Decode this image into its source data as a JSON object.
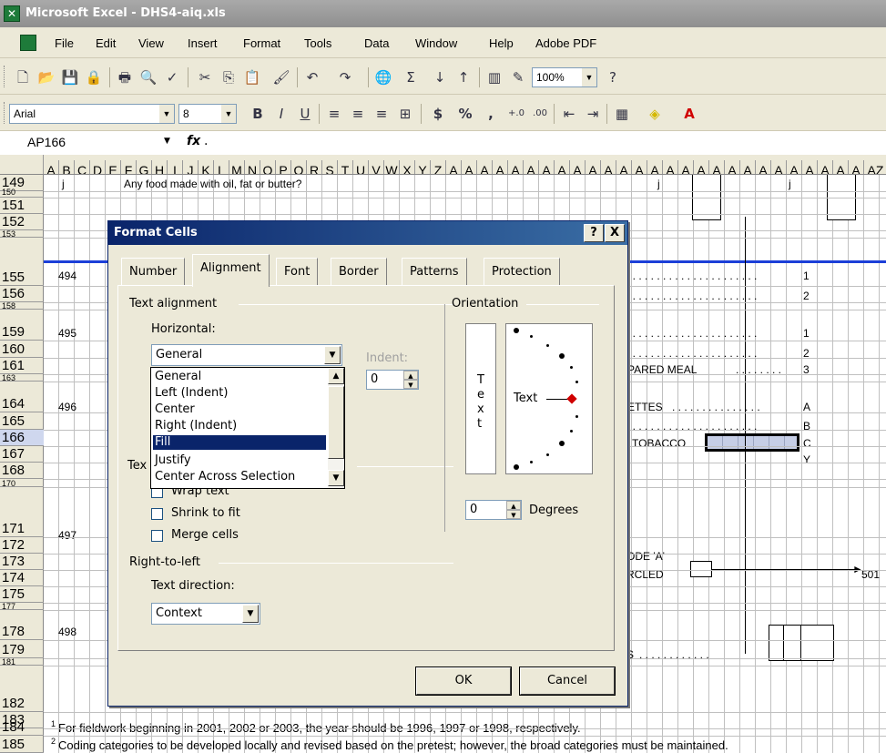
{
  "window": {
    "title": "Microsoft Excel - DHS4-aiq.xls"
  },
  "menu": [
    "File",
    "Edit",
    "View",
    "Insert",
    "Format",
    "Tools",
    "Data",
    "Window",
    "Help",
    "Adobe PDF"
  ],
  "toolbar": {
    "zoom": "100%",
    "font": "Arial",
    "size": "8",
    "currency": "$",
    "percent": "%",
    "comma": ","
  },
  "formula_bar": {
    "name_box": "AP166",
    "fx_label": "fx",
    "value": "."
  },
  "columns": [
    "A",
    "B",
    "C",
    "D",
    "E",
    "F",
    "G",
    "H",
    "I",
    "J",
    "K",
    "L",
    "M",
    "N",
    "O",
    "P",
    "Q",
    "R",
    "S",
    "T",
    "U",
    "V",
    "W",
    "X",
    "Y",
    "Z",
    "A",
    "A",
    "A",
    "A",
    "A",
    "A",
    "A",
    "A",
    "A",
    "A",
    "A",
    "A",
    "A",
    "A",
    "A",
    "A",
    "A",
    "A",
    "A",
    "A",
    "A",
    "A",
    "A",
    "A",
    "A",
    "A",
    "A",
    "AZ"
  ],
  "rows": [
    "149",
    "150",
    "151",
    "152",
    "153",
    "155",
    "156",
    "158",
    "159",
    "160",
    "161",
    "163",
    "164",
    "165",
    "166",
    "167",
    "168",
    "170",
    "171",
    "172",
    "173",
    "174",
    "175",
    "177",
    "178",
    "179",
    "181",
    "182",
    "183",
    "184",
    "185"
  ],
  "sheet": {
    "r149": "Any food made with oil, fat or butter?",
    "q494": "494",
    "q495": "495",
    "q496": "496",
    "q497": "497",
    "q498": "498",
    "c1": "1",
    "c2": "2",
    "c1b": "1",
    "c2b": "2",
    "c3": "3",
    "cA": "A",
    "cB": "B",
    "cC": "C",
    "cY": "Y",
    "j1": "j",
    "j2": "j",
    "j3": "j",
    "pared": "PARED MEAL",
    "ettes": "ETTES",
    "tobacco": "TOBACCO",
    "code_a": "ODE 'A'",
    "rcled": "RCLED",
    "goto": "501",
    "s": "S",
    "fn1": "For fieldwork beginning in 2001, 2002 or 2003, the year should be 1996, 1997 or 1998, respectively.",
    "fn2": "Coding categories to be developed locally and revised based on the pretest; however, the broad categories must be maintained.",
    "fn1_mark": "1",
    "fn2_mark": "2"
  },
  "dialog": {
    "title": "Format Cells",
    "help": "?",
    "close": "X",
    "tabs": [
      "Number",
      "Alignment",
      "Font",
      "Border",
      "Patterns",
      "Protection"
    ],
    "text_alignment": "Text alignment",
    "horizontal_label": "Horizontal:",
    "horizontal_value": "General",
    "horizontal_options": [
      "General",
      "Left (Indent)",
      "Center",
      "Right (Indent)",
      "Fill",
      "Justify",
      "Center Across Selection"
    ],
    "indent_label": "Indent:",
    "indent_value": "0",
    "text_control_partial": "Tex",
    "wrap_text": "Wrap text",
    "shrink_to_fit": "Shrink to fit",
    "merge_cells": "Merge cells",
    "right_to_left": "Right-to-left",
    "text_direction_label": "Text direction:",
    "text_direction_value": "Context",
    "orientation": "Orientation",
    "vertical_text": [
      "T",
      "e",
      "x",
      "t"
    ],
    "dial_text": "Text",
    "degrees_value": "0",
    "degrees_label": "Degrees",
    "ok": "OK",
    "cancel": "Cancel"
  }
}
